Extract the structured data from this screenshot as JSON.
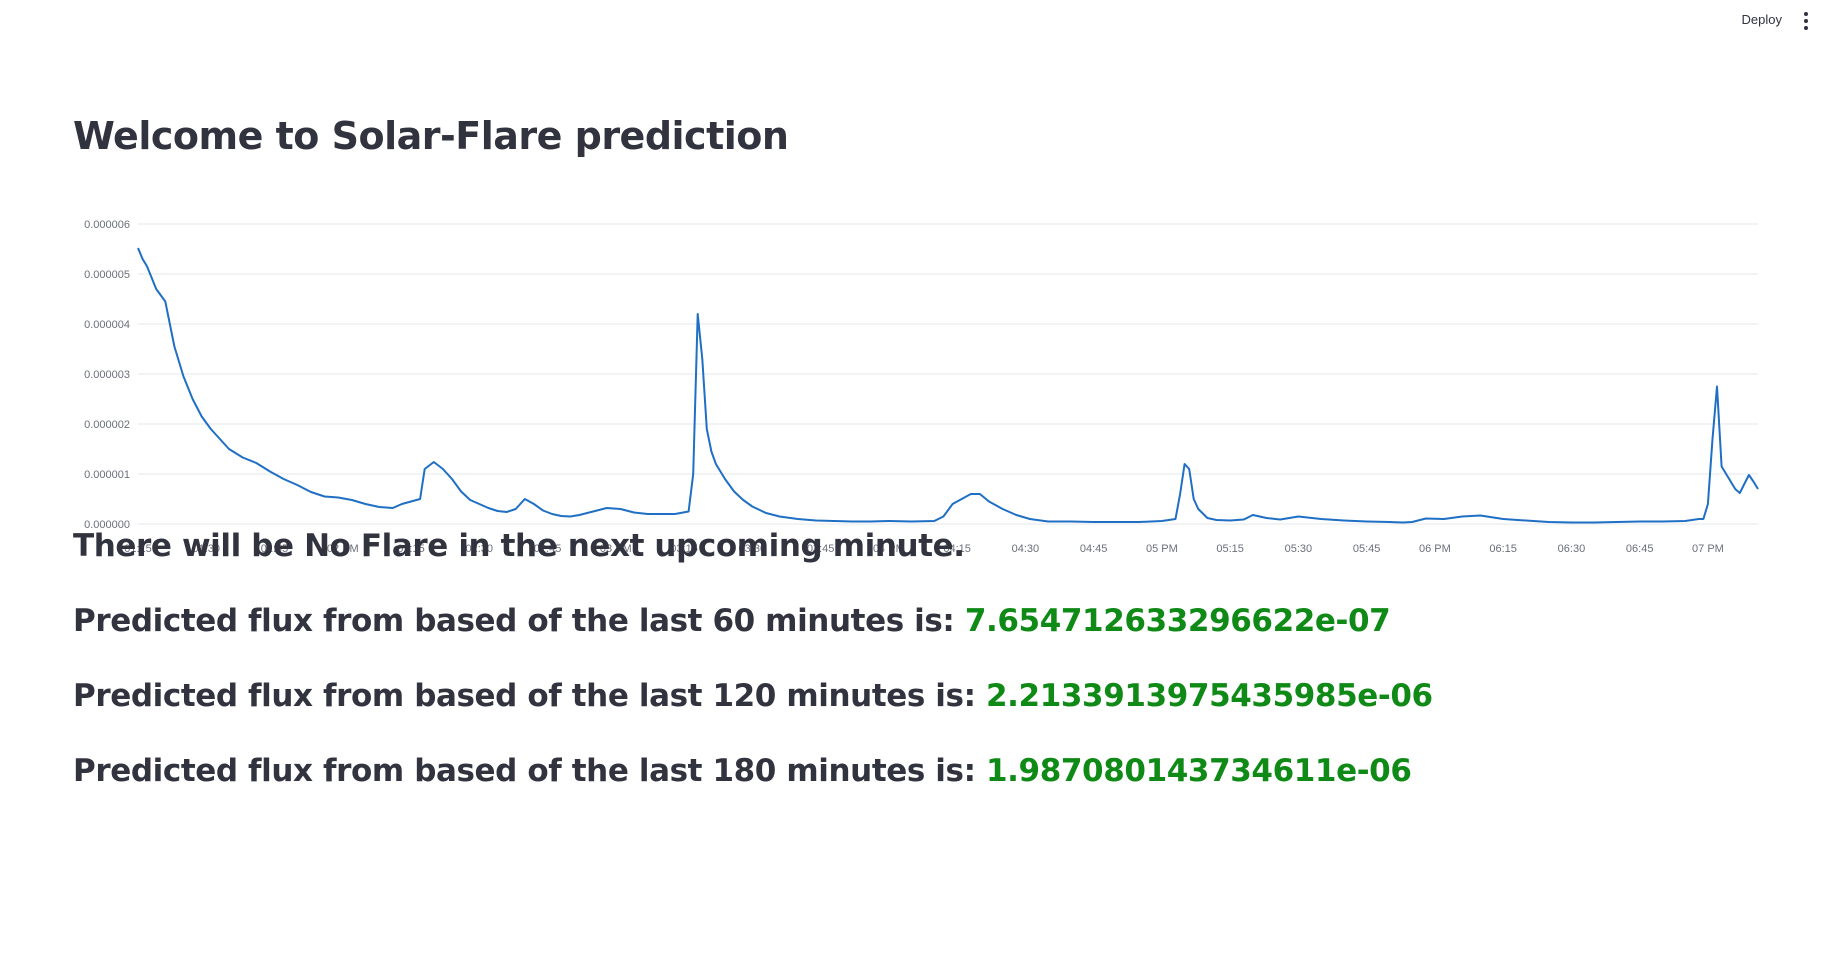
{
  "header": {
    "deploy_label": "Deploy",
    "menu_icon": "vertical-dots-icon"
  },
  "page": {
    "title": "Welcome to Solar-Flare prediction"
  },
  "messages": {
    "flare_status": "There will be No Flare in the next upcoming minute.",
    "pred60_label": "Predicted flux from based of the last 60 minutes is:",
    "pred60_value": "7.654712633296622e-07",
    "pred120_label": "Predicted flux from based of the last 120 minutes is:",
    "pred120_value": "2.2133913975435985e-06",
    "pred180_label": "Predicted flux from based of the last 180 minutes is:",
    "pred180_value": "1.987080143734611e-06"
  },
  "colors": {
    "line": "#1f6fc5",
    "value_text": "#0f8a16",
    "grid": "#e6e7ea"
  },
  "chart_data": {
    "type": "line",
    "title": "",
    "xlabel": "",
    "ylabel": "",
    "grid": true,
    "legend": "none",
    "ylim": [
      0,
      6e-06
    ],
    "xlim": [
      "01:15",
      "07:11"
    ],
    "x_ticks": [
      "01:15",
      "01:30",
      "01:45",
      "02 PM",
      "02:15",
      "02:30",
      "02:45",
      "03 PM",
      "03:15",
      "03:30",
      "03:45",
      "04 PM",
      "04:15",
      "04:30",
      "04:45",
      "05 PM",
      "05:15",
      "05:30",
      "05:45",
      "06 PM",
      "06:15",
      "06:30",
      "06:45",
      "07 PM"
    ],
    "y_ticks": [
      "0.000000",
      "0.000001",
      "0.000002",
      "0.000003",
      "0.000004",
      "0.000005",
      "0.000006"
    ],
    "series": [
      {
        "x": [
          "01:15",
          "01:16",
          "01:17",
          "01:19",
          "01:21",
          "01:23",
          "01:25",
          "01:27",
          "01:29",
          "01:31",
          "01:33",
          "01:35",
          "01:38",
          "01:41",
          "01:44",
          "01:47",
          "01:50",
          "01:53",
          "01:56",
          "01:59",
          "02:02",
          "02:05",
          "02:08",
          "02:11",
          "02:13",
          "02:15",
          "02:17",
          "02:18",
          "02:20",
          "02:22",
          "02:24",
          "02:26",
          "02:28",
          "02:30",
          "02:32",
          "02:34",
          "02:36",
          "02:38",
          "02:40",
          "02:42",
          "02:44",
          "02:46",
          "02:48",
          "02:50",
          "02:52",
          "02:55",
          "02:58",
          "03:01",
          "03:04",
          "03:07",
          "03:10",
          "03:13",
          "03:16",
          "03:17",
          "03:18",
          "03:19",
          "03:20",
          "03:21",
          "03:22",
          "03:24",
          "03:26",
          "03:28",
          "03:30",
          "03:33",
          "03:36",
          "03:40",
          "03:44",
          "03:48",
          "03:52",
          "03:56",
          "04:00",
          "04:05",
          "04:10",
          "04:12",
          "04:14",
          "04:16",
          "04:18",
          "04:20",
          "04:22",
          "04:25",
          "04:28",
          "04:31",
          "04:35",
          "04:40",
          "04:45",
          "04:50",
          "04:55",
          "05:00",
          "05:03",
          "05:04",
          "05:05",
          "05:06",
          "05:07",
          "05:08",
          "05:10",
          "05:12",
          "05:15",
          "05:18",
          "05:20",
          "05:23",
          "05:26",
          "05:30",
          "05:35",
          "05:40",
          "05:45",
          "05:50",
          "05:53",
          "05:55",
          "05:58",
          "06:02",
          "06:06",
          "06:10",
          "06:15",
          "06:20",
          "06:25",
          "06:30",
          "06:35",
          "06:40",
          "06:45",
          "06:50",
          "06:55",
          "06:58",
          "06:59",
          "07:00",
          "07:01",
          "07:02",
          "07:03",
          "07:05",
          "07:06",
          "07:07",
          "07:08",
          "07:09",
          "07:10",
          "07:11"
        ],
        "y": [
          5.52e-06,
          5.3e-06,
          5.15e-06,
          4.7e-06,
          4.45e-06,
          3.55e-06,
          2.95e-06,
          2.5e-06,
          2.15e-06,
          1.9e-06,
          1.7e-06,
          1.5e-06,
          1.33e-06,
          1.22e-06,
          1.05e-06,
          9e-07,
          7.8e-07,
          6.4e-07,
          5.5e-07,
          5.3e-07,
          4.8e-07,
          4e-07,
          3.4e-07,
          3.2e-07,
          4e-07,
          4.5e-07,
          5e-07,
          1.1e-06,
          1.24e-06,
          1.1e-06,
          9e-07,
          6.5e-07,
          4.8e-07,
          4e-07,
          3.2e-07,
          2.6e-07,
          2.4e-07,
          3e-07,
          5e-07,
          4e-07,
          2.7e-07,
          2e-07,
          1.6e-07,
          1.5e-07,
          1.8e-07,
          2.5e-07,
          3.2e-07,
          3e-07,
          2.3e-07,
          2e-07,
          2e-07,
          2e-07,
          2.5e-07,
          1e-06,
          4.2e-06,
          3.3e-06,
          1.9e-06,
          1.45e-06,
          1.2e-06,
          9e-07,
          6.5e-07,
          4.8e-07,
          3.5e-07,
          2.2e-07,
          1.5e-07,
          1e-07,
          7e-08,
          6e-08,
          5e-08,
          5e-08,
          6e-08,
          5e-08,
          6e-08,
          1.5e-07,
          4e-07,
          5e-07,
          6e-07,
          6e-07,
          4.5e-07,
          3e-07,
          1.8e-07,
          1e-07,
          5e-08,
          5e-08,
          4e-08,
          4e-08,
          4e-08,
          6e-08,
          1e-07,
          6e-07,
          1.2e-06,
          1.1e-06,
          5e-07,
          3e-07,
          1.2e-07,
          8e-08,
          7e-08,
          9e-08,
          1.8e-07,
          1.2e-07,
          9e-08,
          1.5e-07,
          1e-07,
          7e-08,
          5e-08,
          4e-08,
          3e-08,
          4e-08,
          1.1e-07,
          1e-07,
          1.5e-07,
          1.7e-07,
          1e-07,
          7e-08,
          4e-08,
          3e-08,
          3e-08,
          4e-08,
          5e-08,
          5e-08,
          6e-08,
          1e-07,
          1e-07,
          4e-07,
          1.7e-06,
          2.75e-06,
          1.15e-06,
          8.5e-07,
          7e-07,
          6.2e-07,
          8e-07,
          9.8e-07,
          8.5e-07,
          7e-07
        ]
      }
    ]
  }
}
